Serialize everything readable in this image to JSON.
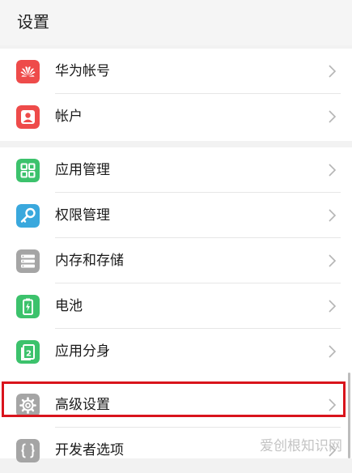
{
  "header": {
    "title": "设置"
  },
  "groups": [
    {
      "items": [
        {
          "label": "华为帐号",
          "icon": "huawei-logo-icon",
          "color": "#ee4b4a"
        },
        {
          "label": "帐户",
          "icon": "user-icon",
          "color": "#ee4b4a"
        }
      ]
    },
    {
      "items": [
        {
          "label": "应用管理",
          "icon": "app-grid-icon",
          "color": "#3cc26c"
        },
        {
          "label": "权限管理",
          "icon": "key-icon",
          "color": "#3aa8dd"
        },
        {
          "label": "内存和存储",
          "icon": "storage-icon",
          "color": "#a5a5a5"
        },
        {
          "label": "电池",
          "icon": "battery-icon",
          "color": "#3cc26c"
        },
        {
          "label": "应用分身",
          "icon": "app-twin-icon",
          "color": "#3cc26c"
        },
        {
          "label": "高级设置",
          "icon": "gear-icon",
          "color": "#a5a5a5",
          "highlighted": true
        },
        {
          "label": "开发者选项",
          "icon": "braces-icon",
          "color": "#a5a5a5"
        }
      ]
    }
  ],
  "highlight_color": "#d9141c",
  "watermark": "爱创根知识网"
}
